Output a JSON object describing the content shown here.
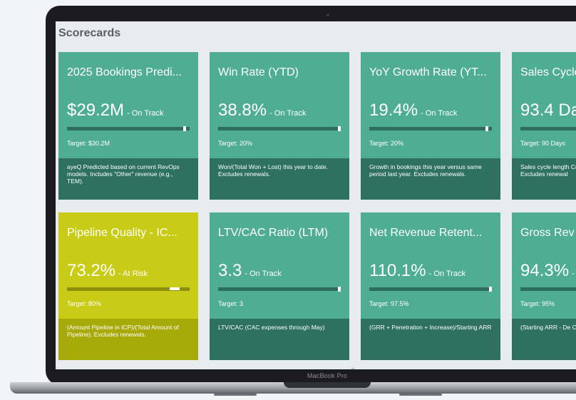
{
  "device": {
    "model_label": "MacBook Pro"
  },
  "section": {
    "title": "Scorecards"
  },
  "cards": [
    {
      "title": "2025 Bookings Predi...",
      "value": "$29.2M",
      "status": "- On Track",
      "progress": 0.97,
      "target": "Target: $30.2M",
      "description": "ayeQ Predicted based on current RevOps models. Includes \"Other\" revenue (e.g., TEM).",
      "state": "on-track"
    },
    {
      "title": "Win Rate (YTD)",
      "value": "38.8%",
      "status": "- On Track",
      "progress": 1.0,
      "target": "Target: 20%",
      "description": "Won/(Total Won + Lost) this year to date. Excludes renewals.",
      "state": "on-track"
    },
    {
      "title": "YoY Growth Rate (YT...",
      "value": "19.4%",
      "status": "- On Track",
      "progress": 0.97,
      "target": "Target: 20%",
      "description": "Growth in bookings this year versus same period last year. Excludes renewals.",
      "state": "on-track"
    },
    {
      "title": "Sales Cycle",
      "value": "93.4 Da",
      "status": "",
      "progress": 1.0,
      "target": "Target: 90 Days",
      "description": "Sales cycle length Created Date) for Excludes renewal",
      "state": "on-track"
    },
    {
      "title": "Pipeline Quality - IC...",
      "value": "73.2%",
      "status": "- At Risk",
      "progress": 0.92,
      "target": "Target: 80%",
      "description": "(Amount Pipeline in ICP)/(Total Amount of Pipeline). Excludes renewals.",
      "state": "at-risk"
    },
    {
      "title": "LTV/CAC Ratio (LTM)",
      "value": "3.3",
      "status": "- On Track",
      "progress": 1.0,
      "target": "Target: 3",
      "description": "LTV/CAC (CAC expenses through May)",
      "state": "on-track"
    },
    {
      "title": "Net Revenue Retent...",
      "value": "110.1%",
      "status": "- On Track",
      "progress": 1.0,
      "target": "Target: 97.5%",
      "description": "(GRR + Penetration + Increase)/Starting ARR",
      "state": "on-track"
    },
    {
      "title": "Gross Rev",
      "value": "94.3%",
      "status": "-",
      "progress": 1.0,
      "target": "Target: 95%",
      "description": "(Starting ARR - De Churn)/Starting A",
      "state": "on-track"
    }
  ],
  "colors": {
    "on_track": "#4fae92",
    "at_risk": "#c9cc16",
    "desc_on_track": "#2f7160",
    "desc_at_risk": "#a8aa0c"
  }
}
